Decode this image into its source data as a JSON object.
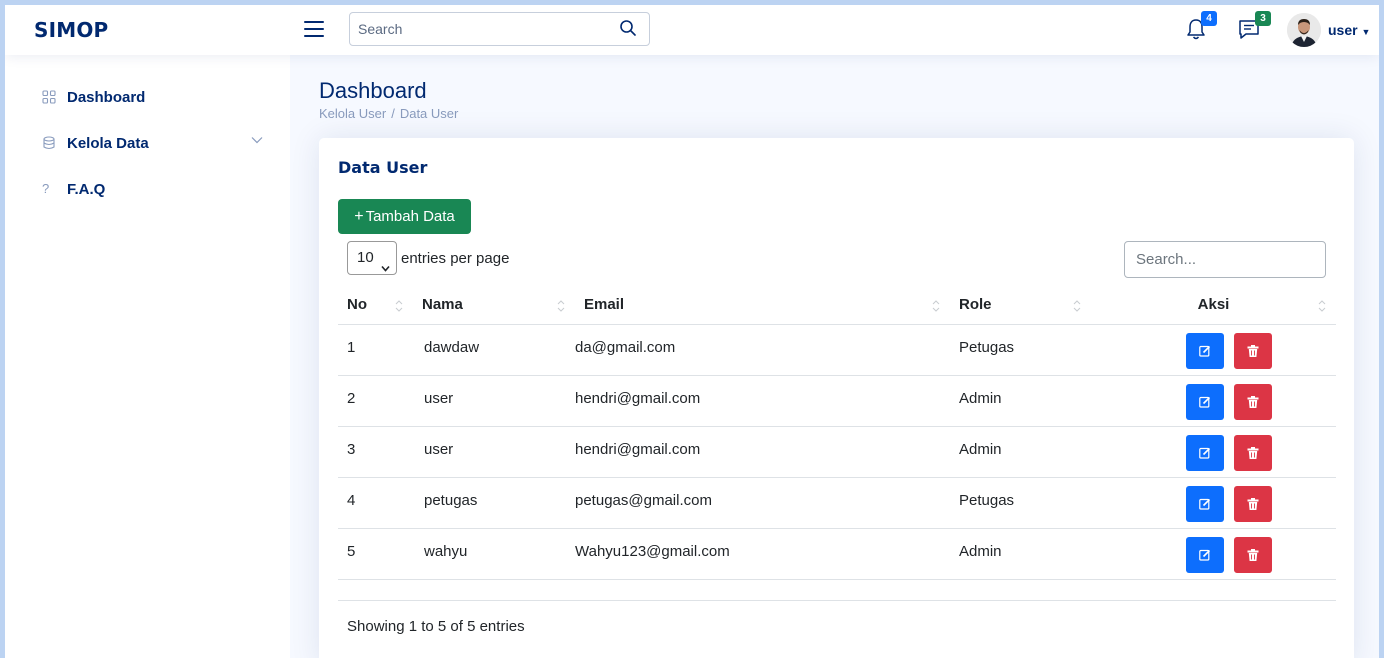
{
  "app": {
    "logo": "SIMOP"
  },
  "header": {
    "search_placeholder": "Search",
    "notifications_count": "4",
    "messages_count": "3",
    "user_name": "user"
  },
  "sidebar": {
    "items": [
      {
        "label": "Dashboard",
        "icon": "grid-icon"
      },
      {
        "label": "Kelola Data",
        "icon": "database-icon",
        "has_submenu": true
      },
      {
        "label": "F.A.Q",
        "icon": "question-icon"
      }
    ]
  },
  "page": {
    "title": "Dashboard",
    "breadcrumb": [
      "Kelola User",
      "Data User"
    ]
  },
  "card": {
    "title": "Data User",
    "add_button": "Tambah Data",
    "per_page_value": "10",
    "per_page_label": "entries per page",
    "search_placeholder": "Search...",
    "columns": [
      "No",
      "Nama",
      "Email",
      "Role",
      "Aksi"
    ],
    "rows": [
      {
        "no": "1",
        "nama": "dawdaw",
        "email": "da@gmail.com",
        "role": "Petugas"
      },
      {
        "no": "2",
        "nama": "user",
        "email": "hendri@gmail.com",
        "role": "Admin"
      },
      {
        "no": "3",
        "nama": "user",
        "email": "hendri@gmail.com",
        "role": "Admin"
      },
      {
        "no": "4",
        "nama": "petugas",
        "email": "petugas@gmail.com",
        "role": "Petugas"
      },
      {
        "no": "5",
        "nama": "wahyu",
        "email": "Wahyu123@gmail.com",
        "role": "Admin"
      }
    ],
    "info": "Showing 1 to 5 of 5 entries"
  },
  "colors": {
    "brand": "#012970",
    "success": "#198754",
    "primary": "#0d6efd",
    "danger": "#dc3545"
  }
}
